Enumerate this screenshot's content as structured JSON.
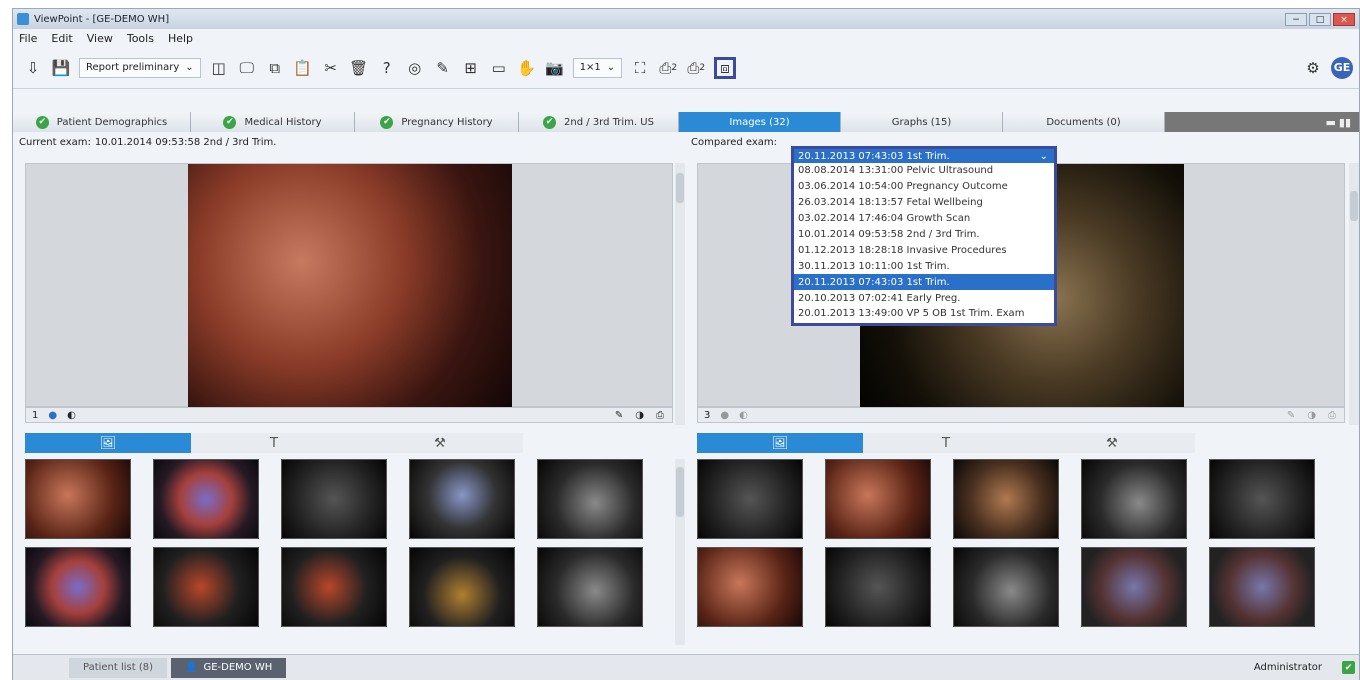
{
  "window": {
    "title": "ViewPoint - [GE-DEMO WH]",
    "minimize": "−",
    "maximize": "□",
    "close": "×"
  },
  "menu": [
    "File",
    "Edit",
    "View",
    "Tools",
    "Help"
  ],
  "toolbar": {
    "report_status": "Report preliminary",
    "layout_value": "1×1",
    "print_count_1": "2",
    "print_count_2": "2",
    "brand_logo": "GE",
    "icons": [
      "import-icon",
      "save-icon",
      "report-icon",
      "monitor-icon",
      "copy-icon",
      "paste-icon",
      "cut-icon",
      "delete-icon",
      "help-icon",
      "globe-icon",
      "edit-icon",
      "grid-icon",
      "archive-icon",
      "hand-icon",
      "camera-icon",
      "fullscreen-icon",
      "print-icon",
      "print-2-icon",
      "compare-icon",
      "settings-icon"
    ]
  },
  "tabs": [
    {
      "label": "Patient Demographics",
      "check": "✔"
    },
    {
      "label": "Medical History",
      "check": "✔"
    },
    {
      "label": "Pregnancy History",
      "check": "✔"
    },
    {
      "label": "2nd / 3rd Trim. US",
      "check": "✔"
    },
    {
      "label": "Images (32)"
    },
    {
      "label": "Graphs (15)"
    },
    {
      "label": "Documents (0)"
    }
  ],
  "current_exam": {
    "label": "Current exam:",
    "value": "10.01.2014 09:53:58 2nd / 3rd Trim.",
    "page": "1"
  },
  "compared_exam": {
    "label": "Compared exam:",
    "selected": "20.11.2013 07:43:03 1st Trim.",
    "page": "3",
    "options": [
      "08.08.2014 13:31:00 Pelvic Ultrasound",
      "03.06.2014 10:54:00 Pregnancy Outcome",
      "26.03.2014 18:13:57 Fetal Wellbeing",
      "03.02.2014 17:46:04 Growth Scan",
      "10.01.2014 09:53:58 2nd / 3rd Trim.",
      "01.12.2013 18:28:18 Invasive Procedures",
      "30.11.2013 10:11:00 1st Trim.",
      "20.11.2013 07:43:03 1st Trim.",
      "20.10.2013 07:02:41 Early Preg.",
      "20.01.2013 13:49:00 VP 5 OB 1st Trim. Exam"
    ]
  },
  "subtabs": {
    "images": "🖼",
    "text": "T",
    "tools": "⚒"
  },
  "statusbar": {
    "patient_list": "Patient list (8)",
    "patient": "GE-DEMO WH",
    "user": "Administrator",
    "ok": "✔"
  }
}
